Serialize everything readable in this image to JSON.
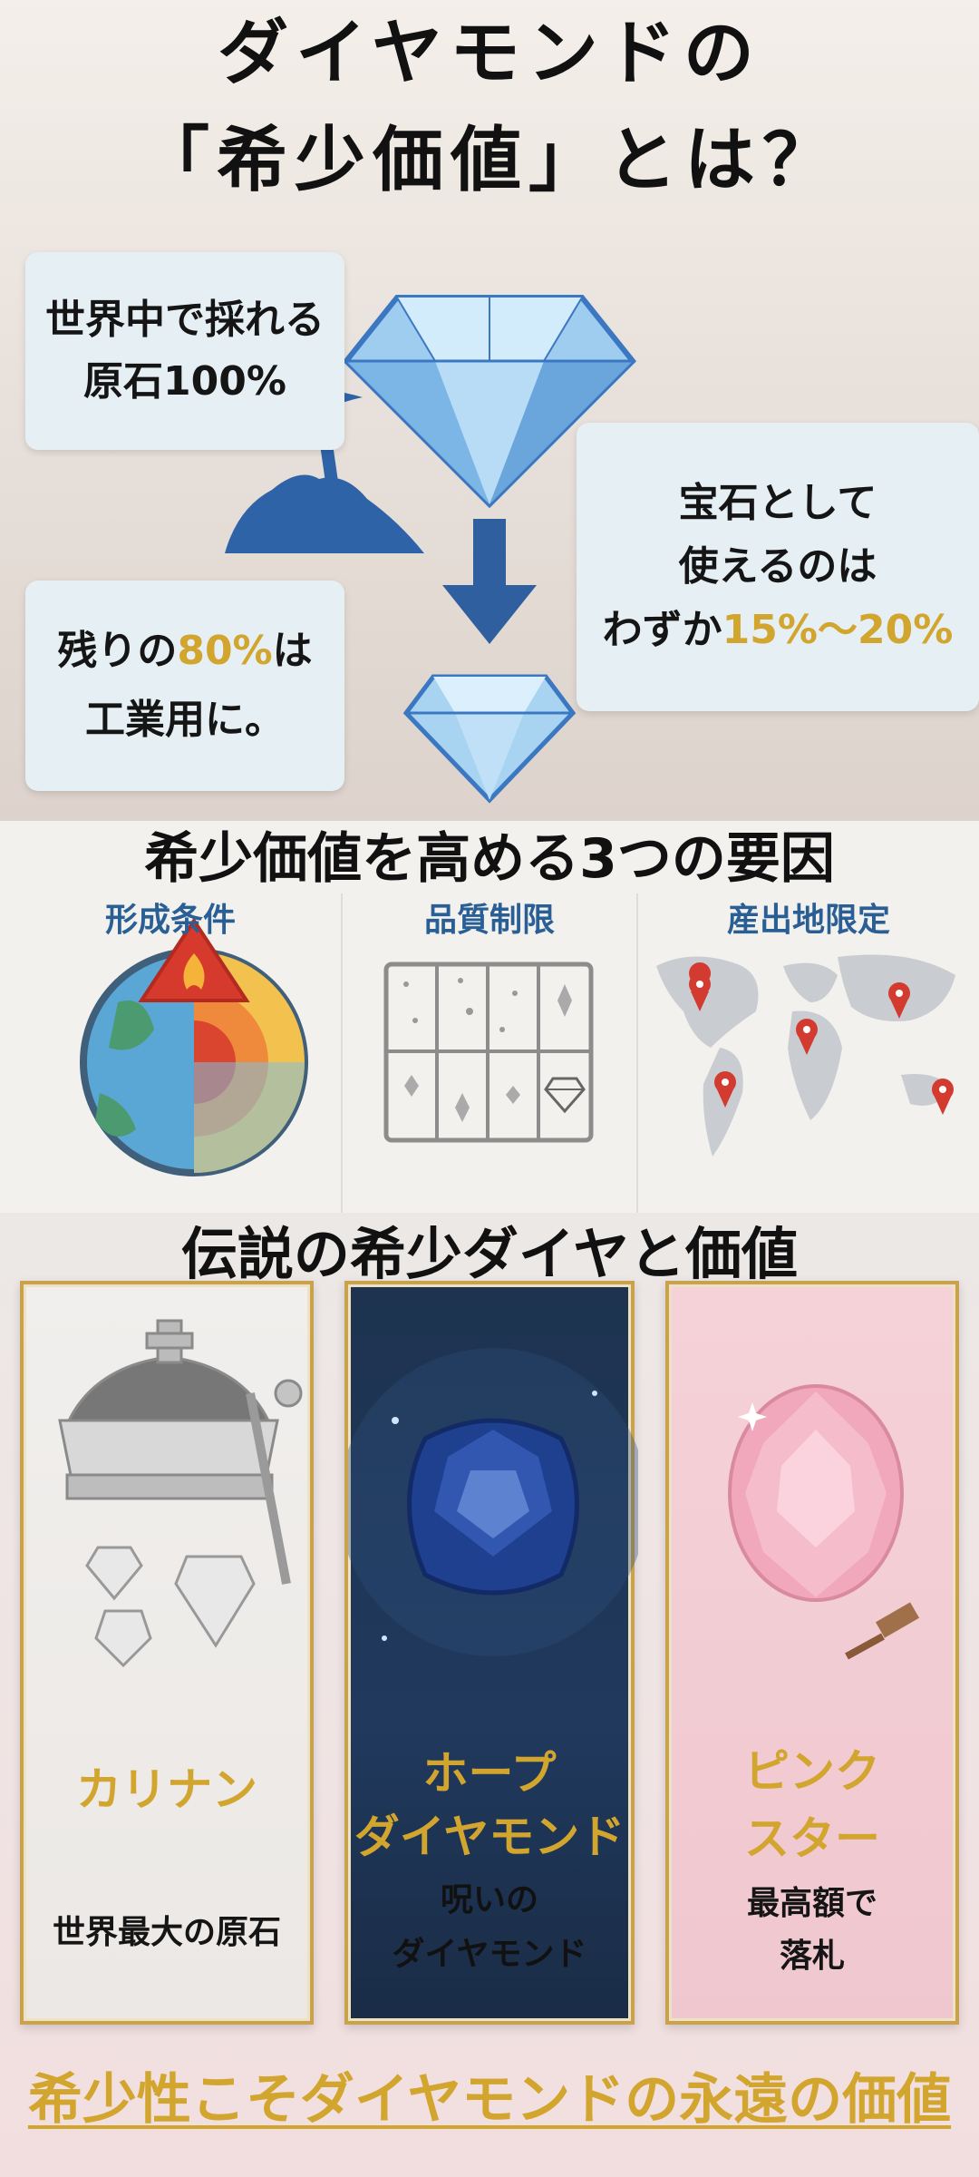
{
  "header": {
    "title_line1": "ダイヤモンドの",
    "title_line2": "「希少価値」とは？"
  },
  "intro": {
    "box1": {
      "line1": "世界中で採れる",
      "line2": "原石100%"
    },
    "box2": {
      "line1": "宝石として",
      "line2": "使えるのは",
      "line3_prefix": "わずか",
      "line3_highlight": "15%〜20%"
    },
    "box3": {
      "line1_prefix": "残りの",
      "line1_highlight": "80%",
      "line1_suffix": "は",
      "line2": "工業用に。"
    },
    "icons": [
      "diamond-icon",
      "pickaxe-mountain-icon",
      "arrow-down-icon",
      "small-diamond-icon"
    ]
  },
  "factors": {
    "title": "希少価値を高める3つの要因",
    "items": [
      {
        "label": "形成条件",
        "icon": "earth-core-icon"
      },
      {
        "label": "品質制限",
        "icon": "quality-grid-icon"
      },
      {
        "label": "産出地限定",
        "icon": "world-map-icon"
      }
    ]
  },
  "legends": {
    "title": "伝説の希少ダイヤと価値",
    "cards": [
      {
        "name_line1": "カリナン",
        "name_line2": "",
        "desc_line1": "世界最大の原石",
        "desc_line2": "",
        "icon": "crown-icon"
      },
      {
        "name_line1": "ホープ",
        "name_line2": "ダイヤモンド",
        "desc_line1": "呪いの",
        "desc_line2": "ダイヤモンド",
        "icon": "blue-diamond-icon"
      },
      {
        "name_line1": "ピンク",
        "name_line2": "スター",
        "desc_line1": "最高額で",
        "desc_line2": "落札",
        "icon": "pink-diamond-icon"
      }
    ]
  },
  "footer": {
    "text": "希少性こそダイヤモンドの永遠の価値"
  },
  "colors": {
    "accent_gold": "#d1a52e",
    "label_blue": "#2a5f95",
    "box_bg": "#e6f0f4"
  }
}
